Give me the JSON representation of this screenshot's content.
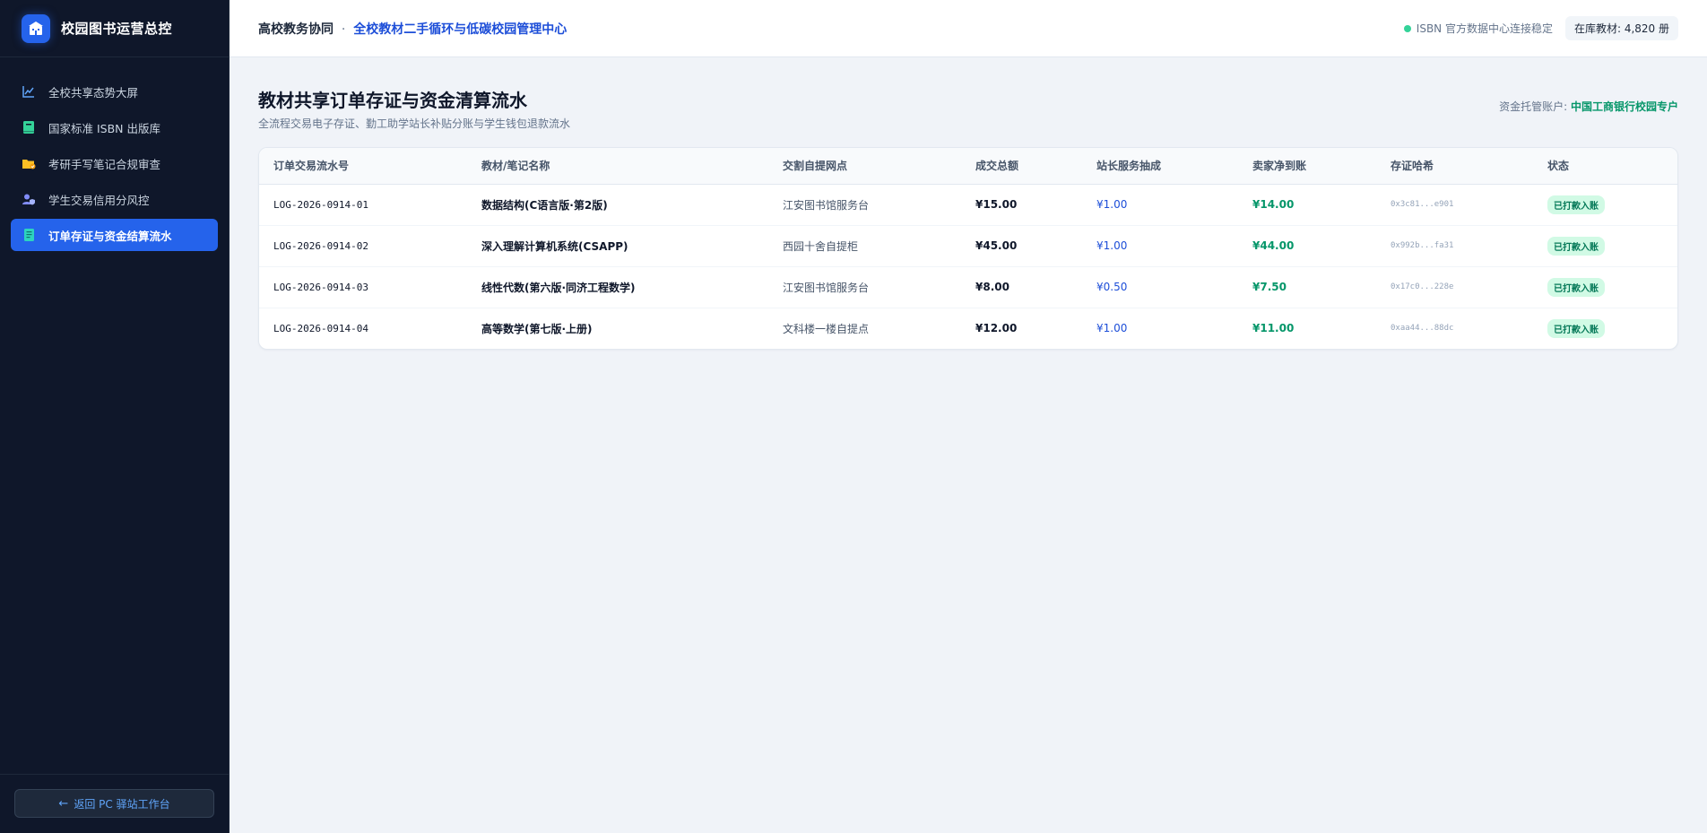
{
  "sidebar": {
    "brand_title": "校园图书运营总控",
    "items": [
      {
        "label": "全校共享态势大屏",
        "icon": "chart-line-icon",
        "color": "#60a5fa"
      },
      {
        "label": "国家标准 ISBN 出版库",
        "icon": "book-icon",
        "color": "#34d399"
      },
      {
        "label": "考研手写笔记合规审查",
        "icon": "folder-check-icon",
        "color": "#fbbf24"
      },
      {
        "label": "学生交易信用分风控",
        "icon": "user-shield-icon",
        "color": "#818cf8"
      },
      {
        "label": "订单存证与资金结算流水",
        "icon": "document-icon",
        "color": "#2dd4bf"
      }
    ],
    "active_index": 4,
    "back_button": "返回 PC 驿站工作台"
  },
  "topbar": {
    "prefix": "高校教务协同",
    "separator": "·",
    "title": "全校教材二手循环与低碳校园管理中心",
    "status_text": "ISBN 官方数据中心连接稳定",
    "stock_badge": "在库教材: 4,820 册"
  },
  "page": {
    "title": "教材共享订单存证与资金清算流水",
    "subtitle": "全流程交易电子存证、勤工助学站长补贴分账与学生钱包退款流水",
    "escrow_label": "资金托管账户:",
    "escrow_bank": "中国工商银行校园专户"
  },
  "table": {
    "headers": [
      "订单交易流水号",
      "教材/笔记名称",
      "交割自提网点",
      "成交总额",
      "站长服务抽成",
      "卖家净到账",
      "存证哈希",
      "状态"
    ],
    "rows": [
      {
        "log": "LOG-2026-0914-01",
        "book": "数据结构(C语言版·第2版)",
        "point": "江安图书馆服务台",
        "total": "¥15.00",
        "fee": "¥1.00",
        "net": "¥14.00",
        "hash": "0x3c81...e901",
        "status": "已打款入账"
      },
      {
        "log": "LOG-2026-0914-02",
        "book": "深入理解计算机系统(CSAPP)",
        "point": "西园十舍自提柜",
        "total": "¥45.00",
        "fee": "¥1.00",
        "net": "¥44.00",
        "hash": "0x992b...fa31",
        "status": "已打款入账"
      },
      {
        "log": "LOG-2026-0914-03",
        "book": "线性代数(第六版·同济工程数学)",
        "point": "江安图书馆服务台",
        "total": "¥8.00",
        "fee": "¥0.50",
        "net": "¥7.50",
        "hash": "0x17c0...228e",
        "status": "已打款入账"
      },
      {
        "log": "LOG-2026-0914-04",
        "book": "高等数学(第七版·上册)",
        "point": "文科楼一楼自提点",
        "total": "¥12.00",
        "fee": "¥1.00",
        "net": "¥11.00",
        "hash": "0xaa44...88dc",
        "status": "已打款入账"
      }
    ]
  },
  "colors": {
    "accent": "#2563eb",
    "sidebar_bg": "#0f172a",
    "success": "#059669",
    "link": "#1d4ed8"
  }
}
